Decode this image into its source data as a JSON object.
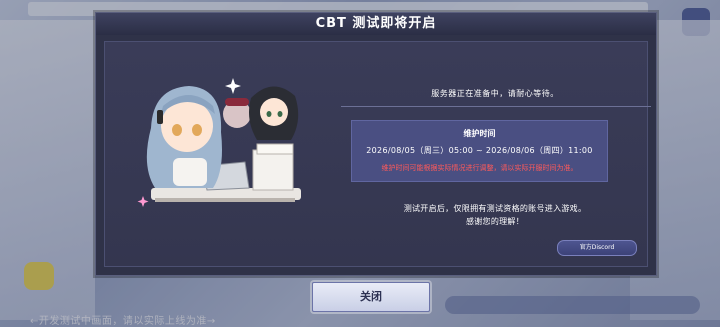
{
  "dialog": {
    "title": "CBT 测试即将开启",
    "waiting_message": "服务器正在准备中，请耐心等待。",
    "maintenance": {
      "title": "维护时间",
      "time_range": "2026/08/05（周三）05:00 ~ 2026/08/06（周四）11:00",
      "note": "维护时间可能根据实际情况进行调整，请以实际开服时间为准。"
    },
    "notice_line1": "测试开启后，仅限拥有测试资格的账号进入游戏。",
    "notice_line2": "感谢您的理解！",
    "discord_label": "官方Discord"
  },
  "close_label": "关闭",
  "background": {
    "bottom_text": "←开发测试中画面，请以实际上线为准→"
  },
  "colors": {
    "dialog_bg": "#2f3248",
    "maintenance_box": "#4a4f82",
    "note_red": "#ff5a5a",
    "button_light": "#e9ecf7"
  }
}
